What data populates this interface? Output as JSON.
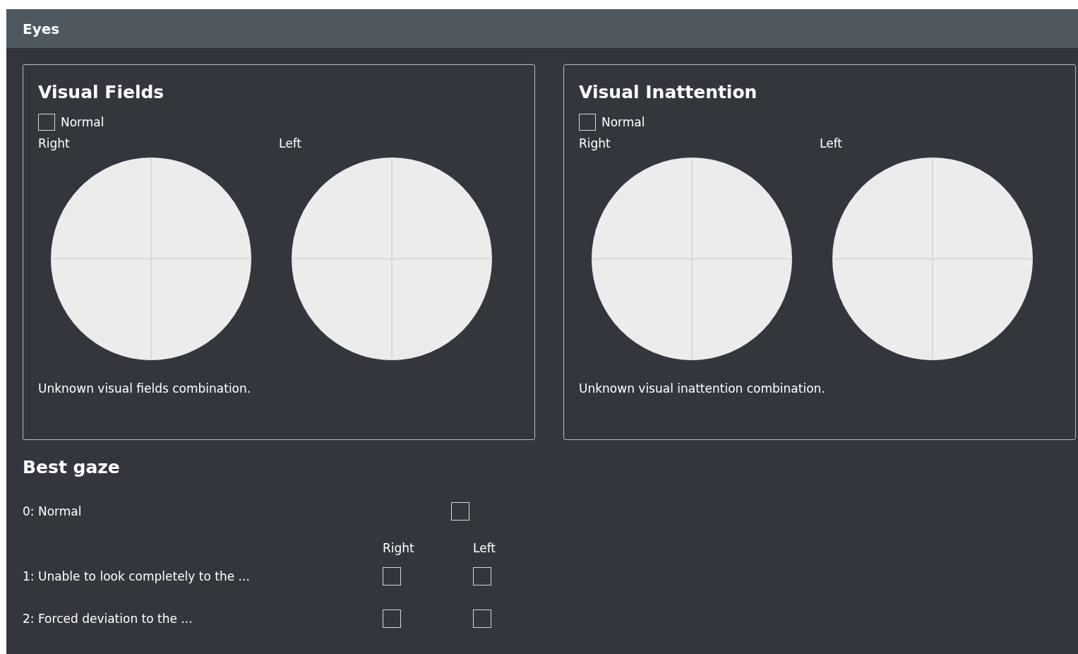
{
  "header": {
    "title": "Eyes"
  },
  "panels": [
    {
      "title": "Visual Fields",
      "normal": {
        "label": "Normal",
        "checked": false
      },
      "eyes": [
        {
          "label": "Right"
        },
        {
          "label": "Left"
        }
      ],
      "summary": "Unknown visual fields combination."
    },
    {
      "title": "Visual Inattention",
      "normal": {
        "label": "Normal",
        "checked": false
      },
      "eyes": [
        {
          "label": "Right"
        },
        {
          "label": "Left"
        }
      ],
      "summary": "Unknown visual inattention combination."
    }
  ],
  "best_gaze": {
    "title": "Best gaze",
    "columns": [
      "Right",
      "Left"
    ],
    "rows": [
      {
        "label": "0: Normal",
        "kind": "single",
        "checks": [
          {
            "checked": false
          }
        ]
      },
      {
        "label": "1: Unable to look completely to the ...",
        "kind": "sided",
        "checks": [
          {
            "checked": false
          },
          {
            "checked": false
          }
        ]
      },
      {
        "label": "2: Forced deviation to the ...",
        "kind": "sided",
        "checks": [
          {
            "checked": false
          },
          {
            "checked": false
          }
        ]
      }
    ]
  }
}
